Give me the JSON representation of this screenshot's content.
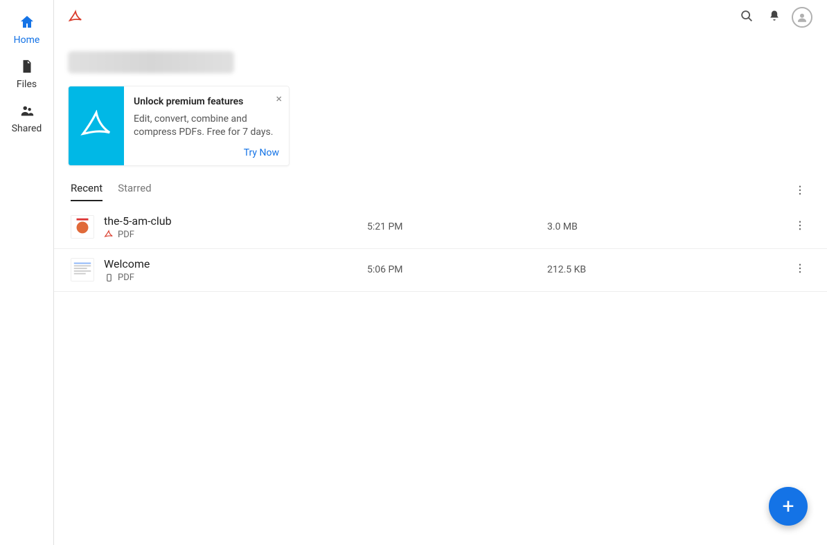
{
  "sidebar": {
    "items": [
      {
        "label": "Home",
        "icon": "home-icon",
        "active": true
      },
      {
        "label": "Files",
        "icon": "file-icon",
        "active": false
      },
      {
        "label": "Shared",
        "icon": "shared-icon",
        "active": false
      }
    ]
  },
  "topbar": {
    "app_icon": "acrobat-icon",
    "search_icon": "search-icon",
    "notifications_icon": "bell-icon",
    "profile_icon": "profile-icon"
  },
  "promo": {
    "title": "Unlock premium features",
    "description": "Edit, convert, combine and compress PDFs. Free for 7 days.",
    "action_label": "Try Now",
    "close_label": "×"
  },
  "tabs": {
    "items": [
      {
        "label": "Recent",
        "active": true
      },
      {
        "label": "Starred",
        "active": false
      }
    ],
    "more_icon": "more-vertical-icon"
  },
  "files": {
    "type_label": "PDF",
    "items": [
      {
        "name": "the-5-am-club",
        "time": "5:21 PM",
        "size": "3.0 MB",
        "source_icon": "pdf-icon"
      },
      {
        "name": "Welcome",
        "time": "5:06 PM",
        "size": "212.5 KB",
        "source_icon": "device-icon"
      }
    ]
  },
  "fab": {
    "label": "+"
  },
  "colors": {
    "accent_blue": "#1473e6",
    "promo_bg": "#00b8e6",
    "acrobat_red": "#d93b2b"
  }
}
